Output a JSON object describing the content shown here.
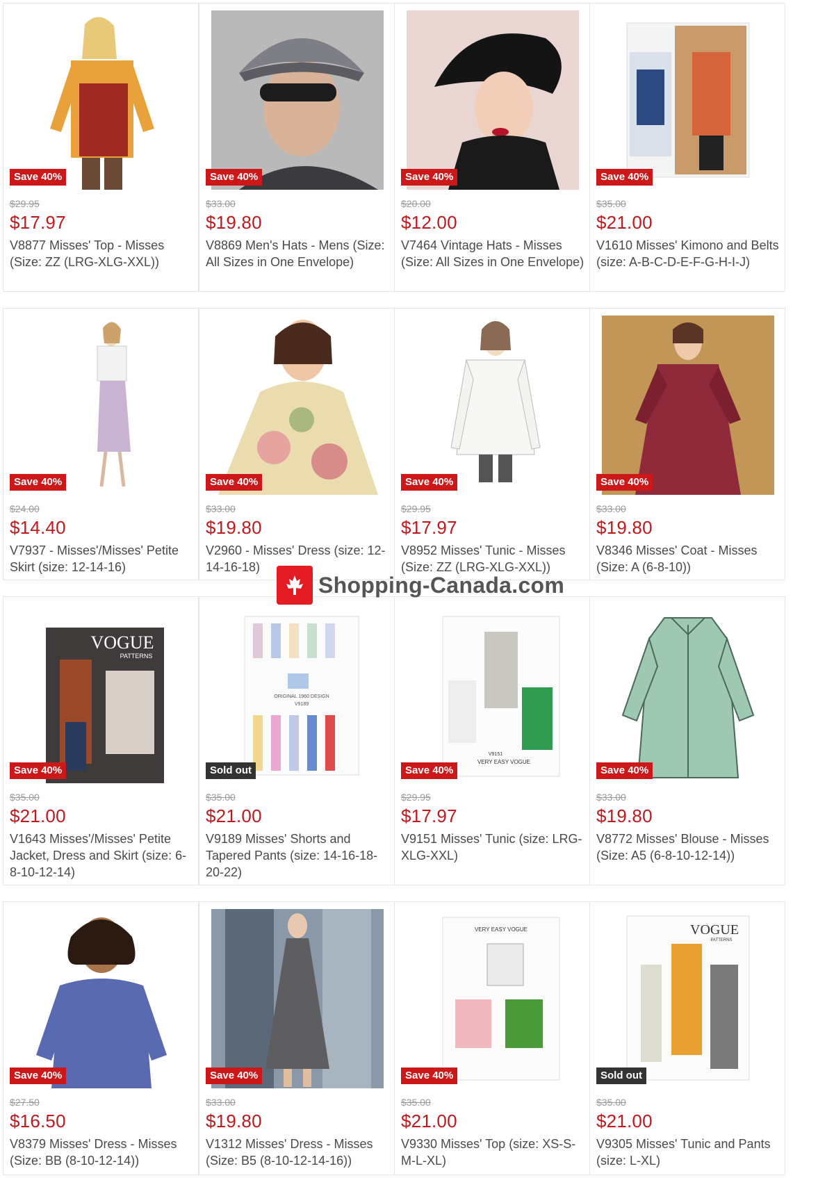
{
  "products": [
    {
      "badge": "Save 40%",
      "old_price": "$29.95",
      "price": "$17.97",
      "title": "V8877 Misses' Top - Misses (Size: ZZ (LRG-XLG-XXL))"
    },
    {
      "badge": "Save 40%",
      "old_price": "$33.00",
      "price": "$19.80",
      "title": "V8869 Men's Hats - Mens (Size: All Sizes in One Envelope)"
    },
    {
      "badge": "Save 40%",
      "old_price": "$20.00",
      "price": "$12.00",
      "title": "V7464 Vintage Hats - Misses (Size: All Sizes in One Envelope)"
    },
    {
      "badge": "Save 40%",
      "old_price": "$35.00",
      "price": "$21.00",
      "title": "V1610 Misses' Kimono and Belts (size: A-B-C-D-E-F-G-H-I-J)"
    },
    {
      "badge": "Save 40%",
      "old_price": "$24.00",
      "price": "$14.40",
      "title": "V7937 - Misses'/Misses' Petite Skirt (size: 12-14-16)"
    },
    {
      "badge": "Save 40%",
      "old_price": "$33.00",
      "price": "$19.80",
      "title": "V2960 - Misses' Dress (size: 12-14-16-18)"
    },
    {
      "badge": "Save 40%",
      "old_price": "$29.95",
      "price": "$17.97",
      "title": "V8952 Misses' Tunic - Misses (Size: ZZ (LRG-XLG-XXL))"
    },
    {
      "badge": "Save 40%",
      "old_price": "$33.00",
      "price": "$19.80",
      "title": "V8346 Misses' Coat - Misses (Size: A (6-8-10))"
    },
    {
      "badge": "Save 40%",
      "old_price": "$35.00",
      "price": "$21.00",
      "title": "V1643 Misses'/Misses' Petite Jacket, Dress and Skirt (size: 6-8-10-12-14)",
      "image_text": [
        "VOGUE",
        "PATTERNS"
      ]
    },
    {
      "badge": "Sold out",
      "old_price": "$35.00",
      "price": "$21.00",
      "title": "V9189 Misses' Shorts and Tapered Pants (size: 14-16-18-20-22)",
      "image_text": [
        "ORIGINAL 1960 DESIGN",
        "V9189"
      ]
    },
    {
      "badge": "Save 40%",
      "old_price": "$29.95",
      "price": "$17.97",
      "title": "V9151 Misses' Tunic (size: LRG-XLG-XXL)",
      "image_text": [
        "V9151",
        "VERY EASY VOGUE"
      ]
    },
    {
      "badge": "Save 40%",
      "old_price": "$33.00",
      "price": "$19.80",
      "title": "V8772 Misses' Blouse - Misses (Size: A5 (6-8-10-12-14))"
    },
    {
      "badge": "Save 40%",
      "old_price": "$27.50",
      "price": "$16.50",
      "title": "V8379 Misses' Dress - Misses (Size: BB (8-10-12-14))"
    },
    {
      "badge": "Save 40%",
      "old_price": "$33.00",
      "price": "$19.80",
      "title": "V1312 Misses' Dress - Misses (Size: B5 (8-10-12-14-16))"
    },
    {
      "badge": "Save 40%",
      "old_price": "$35.00",
      "price": "$21.00",
      "title": "V9330 Misses' Top (size: XS-S-M-L-XL)",
      "image_text": [
        "VERY EASY VOGUE"
      ]
    },
    {
      "badge": "Sold out",
      "old_price": "$35.00",
      "price": "$21.00",
      "title": "V9305 Misses' Tunic and Pants (size: L-XL)",
      "image_text": [
        "VOGUE",
        "PATTERNS"
      ]
    }
  ],
  "watermark": {
    "text": "Shopping-Canada.com"
  },
  "colors": {
    "sale_badge": "#cc1818",
    "soldout_badge": "#333333",
    "price": "#c0181c",
    "watermark_red": "#e31b23"
  }
}
